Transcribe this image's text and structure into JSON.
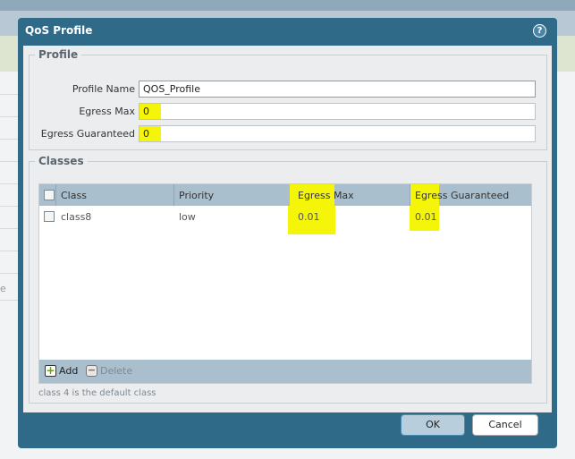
{
  "dialog": {
    "title": "QoS Profile",
    "help_icon": "?"
  },
  "background": {
    "partial_text": "e"
  },
  "profile": {
    "legend": "Profile",
    "profile_name_label": "Profile Name",
    "profile_name_value": "QOS_Profile",
    "egress_max_label": "Egress Max",
    "egress_max_value": "0",
    "egress_guaranteed_label": "Egress Guaranteed",
    "egress_guaranteed_value": "0"
  },
  "classes": {
    "legend": "Classes",
    "columns": [
      "Class",
      "Priority",
      "Egress Max",
      "Egress Guaranteed"
    ],
    "rows": [
      {
        "class": "class8",
        "priority": "low",
        "egress_max": "0.01",
        "egress_guaranteed": "0.01"
      }
    ],
    "add_label": "Add",
    "delete_label": "Delete",
    "note": "class 4 is the default class"
  },
  "buttons": {
    "ok": "OK",
    "cancel": "Cancel"
  },
  "colors": {
    "header": "#2f6a88",
    "highlight": "#f5f50a",
    "grid_header": "#a9bfcd"
  }
}
